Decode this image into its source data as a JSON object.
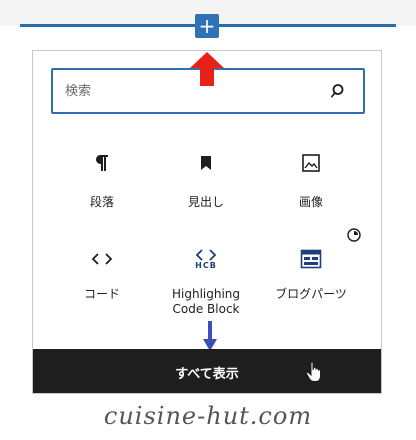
{
  "inserter": {
    "toggle_label": "+"
  },
  "search": {
    "placeholder": "検索",
    "value": ""
  },
  "blocks": [
    {
      "label": "段落",
      "icon": "paragraph-icon"
    },
    {
      "label": "見出し",
      "icon": "bookmark-icon"
    },
    {
      "label": "画像",
      "icon": "image-icon"
    },
    {
      "label": "コード",
      "icon": "code-icon"
    },
    {
      "label": "Highlighing Code Block",
      "label_line1": "Highlighing",
      "label_line2": "Code Block",
      "icon": "hcb-icon",
      "icon_text": "HCB"
    },
    {
      "label": "ブログパーツ",
      "icon": "blog-parts-icon"
    }
  ],
  "browse_all": {
    "label": "すべて表示"
  },
  "watermark": "cuisine-hut.com",
  "colors": {
    "accent": "#2f72b6",
    "annotation_red": "#e8201a",
    "annotation_blue": "#3b4fb8",
    "bar_bg": "#1e1e1e"
  }
}
